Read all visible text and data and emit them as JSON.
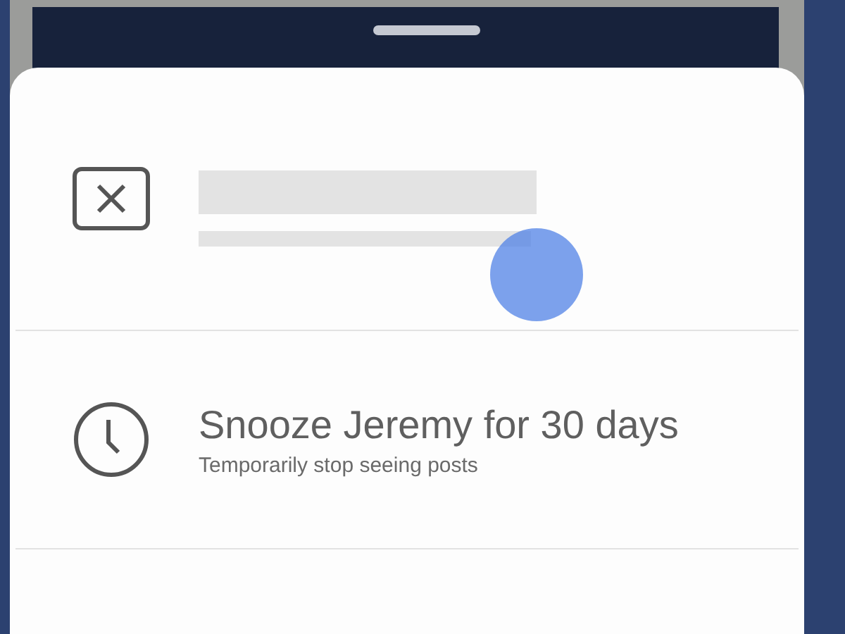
{
  "options": [
    {
      "kind": "placeholder",
      "pressed": true
    },
    {
      "kind": "text",
      "title": "Snooze Jeremy for 30 days",
      "subtitle": "Temporarily stop seeing posts"
    },
    {
      "kind": "blank"
    }
  ]
}
